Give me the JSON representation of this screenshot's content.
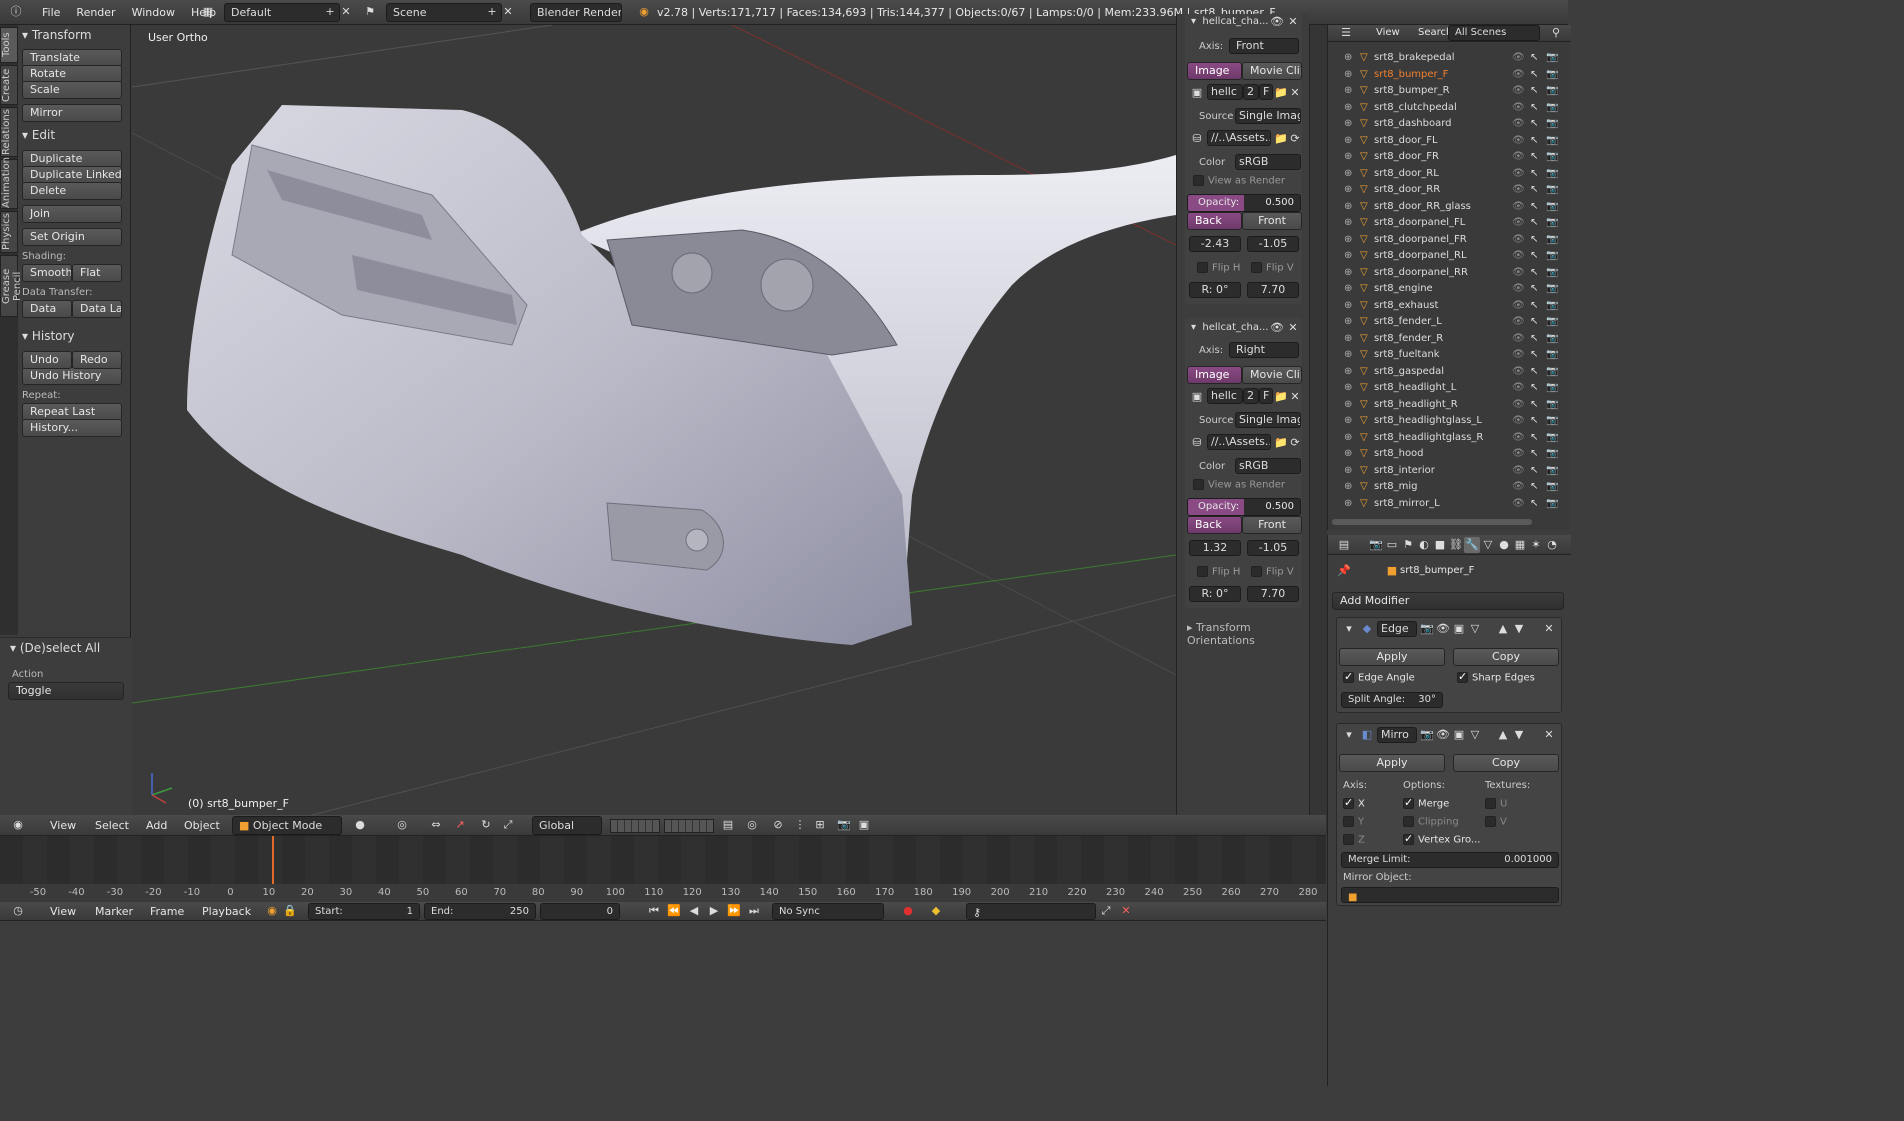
{
  "top_menu": {
    "items": [
      "File",
      "Render",
      "Window",
      "Help"
    ],
    "screen_layout": "Default",
    "scene": "Scene",
    "engine": "Blender Render",
    "stats": "v2.78 | Verts:171,717 | Faces:134,693 | Tris:144,377 | Objects:0/67 | Lamps:0/0 | Mem:233.96M | srt8_bumper_F"
  },
  "tool_tabs": [
    "Tools",
    "Create",
    "Relations",
    "Animation",
    "Physics",
    "Grease Pencil"
  ],
  "tools": {
    "transform_title": "Transform",
    "translate": "Translate",
    "rotate": "Rotate",
    "scale": "Scale",
    "mirror": "Mirror",
    "edit_title": "Edit",
    "duplicate": "Duplicate",
    "duplicate_linked": "Duplicate Linked",
    "delete": "Delete",
    "join": "Join",
    "set_origin": "Set Origin",
    "shading_label": "Shading:",
    "smooth": "Smooth",
    "flat": "Flat",
    "data_transfer_label": "Data Transfer:",
    "data": "Data",
    "data_layo": "Data Layo",
    "history_title": "History",
    "undo": "Undo",
    "redo": "Redo",
    "undo_history": "Undo History",
    "repeat_label": "Repeat:",
    "repeat_last": "Repeat Last",
    "history_btn": "History..."
  },
  "operator": {
    "title": "(De)select All",
    "action_label": "Action",
    "action_value": "Toggle"
  },
  "viewport": {
    "view_label": "User Ortho",
    "object_label": "(0) srt8_bumper_F"
  },
  "bg_images": [
    {
      "name": "hellcat_cha...",
      "axis_label": "Axis:",
      "axis": "Front",
      "tab_image": "Image",
      "tab_movie": "Movie Clip",
      "img_name": "hellc",
      "users": "2",
      "fake": "F",
      "source_label": "Source",
      "source": "Single Image",
      "path": "//..\\Assets...",
      "color_label": "Color",
      "color": "sRGB",
      "view_as_render": "View as Render",
      "opacity_label": "Opacity:",
      "opacity": "0.500",
      "back": "Back",
      "front": "Front",
      "x": "-2.43",
      "y": "-1.05",
      "flip_h": "Flip H",
      "flip_v": "Flip V",
      "rot": "R: 0°",
      "size": "7.70"
    },
    {
      "name": "hellcat_cha...",
      "axis_label": "Axis:",
      "axis": "Right",
      "tab_image": "Image",
      "tab_movie": "Movie Clip",
      "img_name": "hellc",
      "users": "2",
      "fake": "F",
      "source_label": "Source",
      "source": "Single Image",
      "path": "//..\\Assets...",
      "color_label": "Color",
      "color": "sRGB",
      "view_as_render": "View as Render",
      "opacity_label": "Opacity:",
      "opacity": "0.500",
      "back": "Back",
      "front": "Front",
      "x": "1.32",
      "y": "-1.05",
      "flip_h": "Flip H",
      "flip_v": "Flip V",
      "rot": "R: 0°",
      "size": "7.70"
    }
  ],
  "transform_orientations": "Transform Orientations",
  "outliner": {
    "view": "View",
    "search": "Search",
    "scenes": "All Scenes",
    "items": [
      "srt8_brakepedal",
      "srt8_bumper_F",
      "srt8_bumper_R",
      "srt8_clutchpedal",
      "srt8_dashboard",
      "srt8_door_FL",
      "srt8_door_FR",
      "srt8_door_RL",
      "srt8_door_RR",
      "srt8_door_RR_glass",
      "srt8_doorpanel_FL",
      "srt8_doorpanel_FR",
      "srt8_doorpanel_RL",
      "srt8_doorpanel_RR",
      "srt8_engine",
      "srt8_exhaust",
      "srt8_fender_L",
      "srt8_fender_R",
      "srt8_fueltank",
      "srt8_gaspedal",
      "srt8_headlight_L",
      "srt8_headlight_R",
      "srt8_headlightglass_L",
      "srt8_headlightglass_R",
      "srt8_hood",
      "srt8_interior",
      "srt8_mig",
      "srt8_mirror_L"
    ],
    "selected": "srt8_bumper_F"
  },
  "properties": {
    "object_name": "srt8_bumper_F",
    "add_modifier": "Add Modifier",
    "edge": {
      "name": "Edge",
      "apply": "Apply",
      "copy": "Copy",
      "edge_angle": "Edge Angle",
      "sharp_edges": "Sharp Edges",
      "split_angle_label": "Split Angle:",
      "split_angle": "30°"
    },
    "mirror": {
      "name": "Mirro",
      "apply": "Apply",
      "copy": "Copy",
      "axis_label": "Axis:",
      "options_label": "Options:",
      "textures_label": "Textures:",
      "x": "X",
      "y": "Y",
      "z": "Z",
      "merge": "Merge",
      "clipping": "Clipping",
      "vertex_groups": "Vertex Gro...",
      "u": "U",
      "v": "V",
      "merge_limit_label": "Merge Limit:",
      "merge_limit": "0.001000",
      "mirror_object": "Mirror Object:"
    }
  },
  "viewport_header": {
    "view": "View",
    "select": "Select",
    "add": "Add",
    "object": "Object",
    "mode": "Object Mode",
    "orientation": "Global"
  },
  "timeline": {
    "ticks": [
      "-50",
      "-40",
      "-30",
      "-20",
      "-10",
      "0",
      "10",
      "20",
      "30",
      "40",
      "50",
      "60",
      "70",
      "80",
      "90",
      "100",
      "110",
      "120",
      "130",
      "140",
      "150",
      "160",
      "170",
      "180",
      "190",
      "200",
      "210",
      "220",
      "230",
      "240",
      "250",
      "260",
      "270",
      "280"
    ],
    "view": "View",
    "marker": "Marker",
    "frame": "Frame",
    "playback": "Playback",
    "start_label": "Start:",
    "start": "1",
    "end_label": "End:",
    "end": "250",
    "current": "0",
    "sync": "No Sync"
  }
}
